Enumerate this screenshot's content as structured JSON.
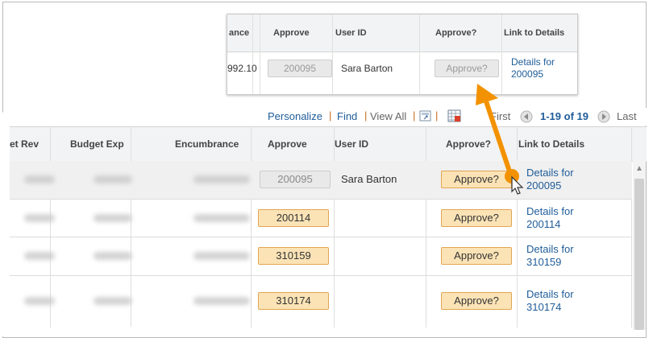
{
  "toolbar": {
    "personalize": "Personalize",
    "find": "Find",
    "view_all": "View All",
    "sep": "|",
    "first": "First",
    "range": "1-19 of 19",
    "last": "Last"
  },
  "headers": {
    "net_rev": "et Rev",
    "budget_exp": "Budget Exp",
    "encumbrance": "Encumbrance",
    "approve": "Approve",
    "user_id": "User ID",
    "approve_q": "Approve?",
    "link": "Link to Details"
  },
  "inset": {
    "headers": {
      "encumbrance": "ance",
      "approve": "Approve",
      "user_id": "User ID",
      "approve_q": "Approve?",
      "link": "Link to Details"
    },
    "encumbrance_value": "992.10",
    "approve_value": "200095",
    "user_name": "Sara Barton",
    "approve_q_label": "Approve?",
    "link_line1": "Details for",
    "link_line2": "200095"
  },
  "rows": [
    {
      "approve_value": "200095",
      "user_name": "Sara Barton",
      "approve_q_label": "Approve?",
      "link_line1": "Details for",
      "link_line2": "200095",
      "disabled": true
    },
    {
      "approve_value": "200114",
      "user_name": "",
      "approve_q_label": "Approve?",
      "link_line1": "Details for",
      "link_line2": "200114",
      "disabled": false
    },
    {
      "approve_value": "310159",
      "user_name": "",
      "approve_q_label": "Approve?",
      "link_line1": "Details for",
      "link_line2": "310159",
      "disabled": false
    },
    {
      "approve_value": "310174",
      "user_name": "",
      "approve_q_label": "Approve?",
      "link_line1": "Details for",
      "link_line2": "310174",
      "disabled": false
    }
  ],
  "colors": {
    "link": "#1f5c99",
    "button_fill": "#fbe3b6",
    "button_border": "#e2a552",
    "arrow": "#f39200",
    "header_bg": "#f2f3f5"
  }
}
